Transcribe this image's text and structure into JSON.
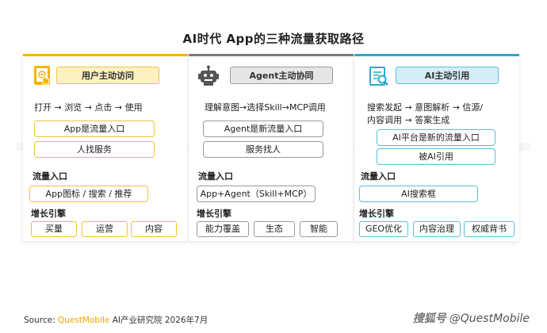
{
  "title": "AI时代 App的三种流量获取路径",
  "panels": [
    {
      "header": "用户主动访问",
      "icon": "hand-touch-phone-icon",
      "flow": [
        "打开 → 浏览 → 点击 → 使用"
      ],
      "pills": [
        "App是流量入口",
        "人找服务"
      ],
      "entry_label": "流量入口",
      "entry": "App图标 / 搜索 / 推荐",
      "growth_label": "增长引擎",
      "tags": [
        "买量",
        "运营",
        "内容"
      ]
    },
    {
      "header": "Agent主动协同",
      "icon": "robot-icon",
      "flow": [
        "理解意图→选择Skill→MCP调用"
      ],
      "pills": [
        "Agent是新流量入口",
        "服务找人"
      ],
      "entry_label": "流量入口",
      "entry": "App+Agent（Skill+MCP）",
      "growth_label": "增长引擎",
      "tags": [
        "能力覆盖",
        "生态",
        "智能"
      ]
    },
    {
      "header": "AI主动引用",
      "icon": "ai-search-document-icon",
      "flow": [
        "搜索发起 → 意图解析 → 信源/",
        "内容调用 → 答案生成"
      ],
      "pills": [
        "AI平台是新的流量入口",
        "被AI引用"
      ],
      "entry_label": "流量入口",
      "entry": "AI搜索框",
      "growth_label": "增长引擎",
      "tags": [
        "GEO优化",
        "内容治理",
        "权威背书"
      ]
    }
  ],
  "footer": {
    "source_label": "Source:",
    "brand": "QuestMobile",
    "source_rest": " AI产业研究院 2026年7月",
    "watermark_logo": "搜狐号",
    "watermark_text": "@QuestMobile"
  },
  "colors": {
    "panel1_accent": "#f4b400",
    "panel2_accent": "#7a7a7a",
    "panel3_accent": "#2aa9cc"
  }
}
